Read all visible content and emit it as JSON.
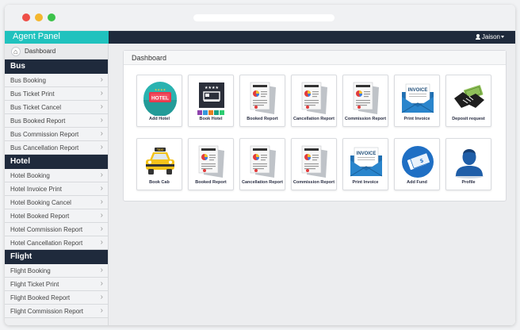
{
  "topbar": {
    "brand": "Agent Panel",
    "user": "Jaison"
  },
  "sidebar": {
    "dashboard": "Dashboard",
    "sections": [
      {
        "title": "Bus",
        "items": [
          "Bus Booking",
          "Bus Ticket Print",
          "Bus Ticket Cancel",
          "Bus Booked Report",
          "Bus Commission Report",
          "Bus Cancellation Report"
        ]
      },
      {
        "title": "Hotel",
        "items": [
          "Hotel Booking",
          "Hotel Invoice Print",
          "Hotel Booking Cancel",
          "Hotel Booked Report",
          "Hotel Commission Report",
          "Hotel Cancellation Report"
        ]
      },
      {
        "title": "Flight",
        "items": [
          "Flight Booking",
          "Flight Ticket Print",
          "Flight Booked Report",
          "Flight Commission Report"
        ]
      }
    ]
  },
  "main": {
    "panel_title": "Dashboard",
    "tiles": [
      {
        "label": "Add Hotel",
        "icon": "hotel-sign-icon"
      },
      {
        "label": "Book Hotel",
        "icon": "hotel-bed-icon"
      },
      {
        "label": "Booked Report",
        "icon": "report-document-icon"
      },
      {
        "label": "Cancellation Report",
        "icon": "report-document-icon"
      },
      {
        "label": "Commission Report",
        "icon": "report-document-icon"
      },
      {
        "label": "Print Invoice",
        "icon": "invoice-envelope-icon",
        "icon_text": "INVOICE"
      },
      {
        "label": "Deposit request",
        "icon": "handshake-money-icon"
      },
      {
        "label": "Book Cab",
        "icon": "taxi-icon",
        "icon_text": "TAXI"
      },
      {
        "label": "Booked Report",
        "icon": "report-document-icon"
      },
      {
        "label": "Cancellation Report",
        "icon": "report-document-icon"
      },
      {
        "label": "Commission Report",
        "icon": "report-document-icon"
      },
      {
        "label": "Print Invoice",
        "icon": "invoice-envelope-icon",
        "icon_text": "INVOICE"
      },
      {
        "label": "Add Fund",
        "icon": "add-fund-icon"
      },
      {
        "label": "Profile",
        "icon": "profile-icon"
      }
    ]
  },
  "colors": {
    "brand": "#20c2be",
    "navbar": "#1f2a3c",
    "tile_label": "#2a2f44"
  }
}
